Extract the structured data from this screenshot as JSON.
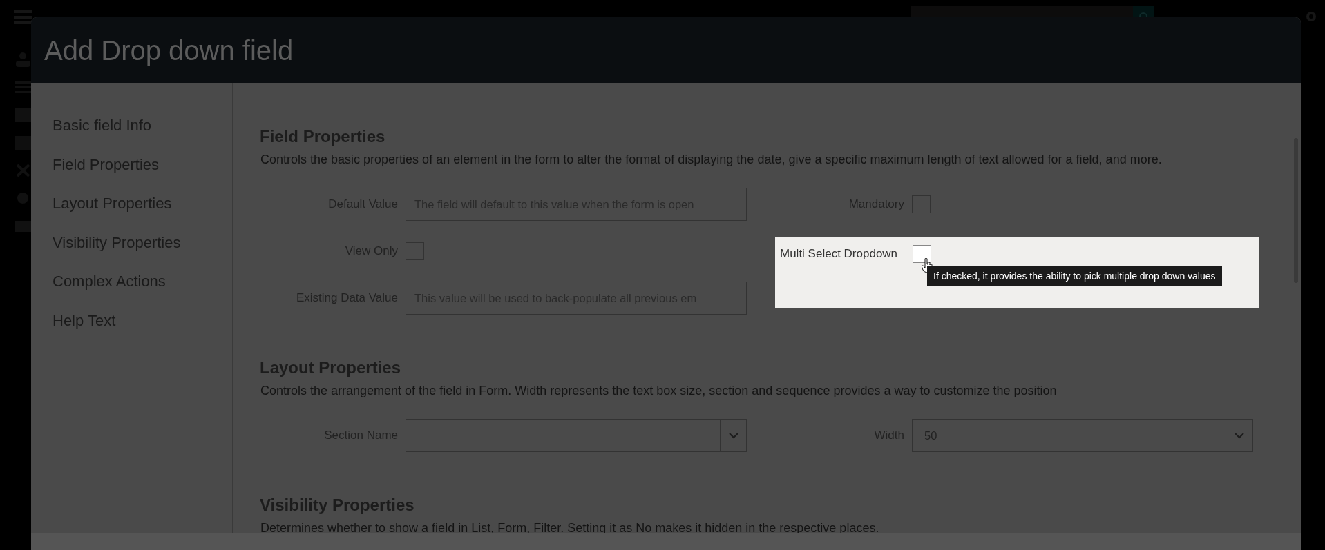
{
  "modal": {
    "title": "Add Drop down field"
  },
  "nav": [
    {
      "label": "Basic field Info"
    },
    {
      "label": "Field Properties"
    },
    {
      "label": "Layout Properties"
    },
    {
      "label": "Visibility Properties"
    },
    {
      "label": "Complex Actions"
    },
    {
      "label": "Help Text"
    }
  ],
  "sections": [
    {
      "title": "Field Properties",
      "description": "Controls the basic properties of an element in the form to alter the format of displaying the date, give a specific maximum length of text allowed for a field, and more.",
      "fields": [
        {
          "label": "Default Value",
          "kind": "text",
          "placeholder": "The field will default to this value when the form is open"
        },
        {
          "label": "Mandatory",
          "kind": "checkbox",
          "checked": false
        },
        {
          "label": "View Only",
          "kind": "checkbox",
          "checked": false
        },
        {
          "label": "Multi Select Dropdown",
          "kind": "checkbox",
          "checked": false,
          "highlighted": true,
          "tooltip": "If checked, it provides the ability to pick multiple drop down values"
        },
        {
          "label": "Existing Data Value",
          "kind": "text",
          "placeholder": "This value will be used to back-populate all previous em"
        }
      ]
    },
    {
      "title": "Layout Properties",
      "description": "Controls the arrangement of the field in Form. Width represents the text box size, section and sequence provides a way to customize the position",
      "fields": [
        {
          "label": "Section Name",
          "kind": "combo"
        },
        {
          "label": "Width",
          "kind": "select",
          "value": "50"
        }
      ]
    },
    {
      "title": "Visibility Properties",
      "description": "Determines whether to show a field in List, Form, Filter. Setting it as No makes it hidden in the respective places."
    }
  ]
}
